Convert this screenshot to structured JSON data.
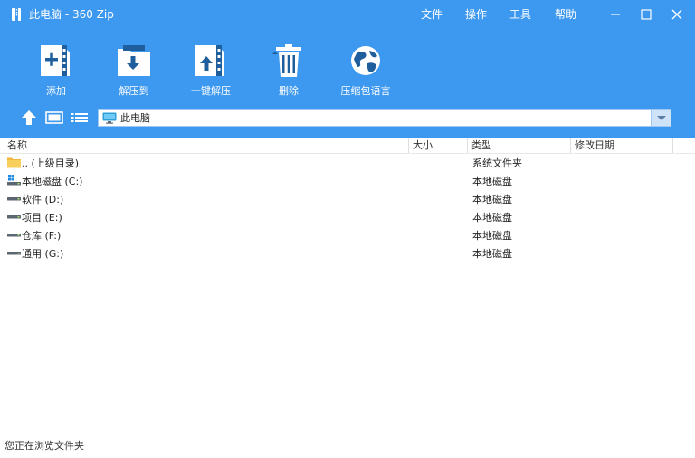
{
  "window": {
    "title": "此电脑 - 360 Zip",
    "menu": [
      "文件",
      "操作",
      "工具",
      "帮助"
    ]
  },
  "toolbar": {
    "items": [
      {
        "label": "添加",
        "icon": "add-archive-icon"
      },
      {
        "label": "解压到",
        "icon": "extract-to-icon"
      },
      {
        "label": "一键解压",
        "icon": "one-click-extract-icon"
      },
      {
        "label": "删除",
        "icon": "trash-icon"
      },
      {
        "label": "压缩包语言",
        "icon": "globe-icon"
      }
    ]
  },
  "address": {
    "icon": "monitor-icon",
    "value": "此电脑"
  },
  "columns": [
    "名称",
    "大小",
    "类型",
    "修改日期"
  ],
  "rows": [
    {
      "name": ".. (上级目录)",
      "type": "系统文件夹",
      "icon": "folder-icon"
    },
    {
      "name": "本地磁盘 (C:)",
      "type": "本地磁盘",
      "icon": "system-drive-icon"
    },
    {
      "name": "软件 (D:)",
      "type": "本地磁盘",
      "icon": "drive-icon"
    },
    {
      "name": "项目 (E:)",
      "type": "本地磁盘",
      "icon": "drive-icon"
    },
    {
      "name": "仓库 (F:)",
      "type": "本地磁盘",
      "icon": "drive-icon"
    },
    {
      "name": "通用 (G:)",
      "type": "本地磁盘",
      "icon": "drive-icon"
    }
  ],
  "status": "您正在浏览文件夹",
  "colors": {
    "header_blue": "#3d98ef",
    "toolbar_icon_dark": "#1f5e9c"
  }
}
